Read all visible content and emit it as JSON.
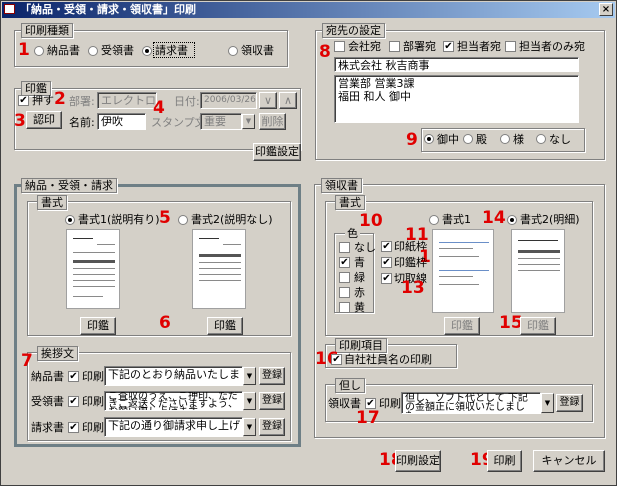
{
  "window": {
    "title": "「納品・受領・請求・領収書」印刷",
    "close": "×"
  },
  "markers": [
    "1",
    "2",
    "3",
    "4",
    "5",
    "6",
    "7",
    "8",
    "9",
    "10",
    "11",
    "12",
    "13",
    "14",
    "15",
    "16",
    "17",
    "18",
    "19"
  ],
  "print_type": {
    "title": "印刷種類",
    "options": [
      "納品書",
      "受領書",
      "請求書",
      "領収書"
    ],
    "selected": "請求書"
  },
  "seal": {
    "title": "印鑑",
    "stamp_check": "押す",
    "dept_label": "部署:",
    "dept_value": "エレクトロ",
    "date_label": "日付:",
    "date_value": "2006/03/26",
    "seal_button": "認印",
    "name_label": "名前:",
    "name_value": "伊吹",
    "stamp_text_label": "スタンプ文",
    "stamp_text_value": "重要",
    "delete_button": "削除",
    "arrow_down": "∨",
    "arrow_up": "∧"
  },
  "seal_settings_button": "印鑑設定",
  "address": {
    "title": "宛先の設定",
    "checks": [
      {
        "label": "会社宛",
        "checked": false
      },
      {
        "label": "部署宛",
        "checked": false
      },
      {
        "label": "担当者宛",
        "checked": true
      },
      {
        "label": "担当者のみ宛",
        "checked": false
      }
    ],
    "company": "株式会社 秋吉商事",
    "detail_line1": "営業部  営業3課",
    "detail_line2": "福田  和人 御中",
    "honorifics": [
      {
        "label": "御中",
        "selected": true
      },
      {
        "label": "殿",
        "selected": false
      },
      {
        "label": "様",
        "selected": false
      },
      {
        "label": "なし",
        "selected": false
      }
    ]
  },
  "delivery": {
    "title": "納品・受領・請求",
    "format_title": "書式",
    "format1": "書式1(説明有り)",
    "format2": "書式2(説明なし)",
    "seal_button1": "印鑑",
    "seal_button2": "印鑑"
  },
  "greeting": {
    "title": "挨拶文",
    "print_label": "印刷",
    "register": "登録",
    "rows": [
      {
        "doc": "納品書",
        "text": "下記のとおり納品いたしました。"
      },
      {
        "doc": "受領書",
        "text": "ご査収のうえ、ご押印、ただきご返送くださいますよう、お願い申し上げます。"
      },
      {
        "doc": "請求書",
        "text": "下記の通り御請求申し上げます。"
      }
    ]
  },
  "receipt": {
    "title": "領収書",
    "format_title": "書式",
    "color_title": "色",
    "colors": [
      {
        "label": "なし",
        "checked": false
      },
      {
        "label": "青",
        "checked": true
      },
      {
        "label": "緑",
        "checked": false
      },
      {
        "label": "赤",
        "checked": false
      },
      {
        "label": "黄",
        "checked": false
      }
    ],
    "frame_checks": [
      {
        "label": "印紙枠",
        "checked": true
      },
      {
        "label": "印鑑枠",
        "checked": true
      },
      {
        "label": "切取線",
        "checked": true
      }
    ],
    "format1": "書式1",
    "format2": "書式2(明細)",
    "seal_button1": "印鑑",
    "seal_button2": "印鑑"
  },
  "print_items": {
    "title": "印刷項目",
    "company_name": "自社社員名の印刷"
  },
  "note": {
    "title": "但し",
    "doc": "領収書",
    "print_label": "印刷",
    "text": "但し、ソフト代として 下記の金額正に領収いたしました。",
    "register": "登録"
  },
  "footer": {
    "print_settings": "印刷設定",
    "print": "印刷",
    "cancel": "キャンセル"
  }
}
